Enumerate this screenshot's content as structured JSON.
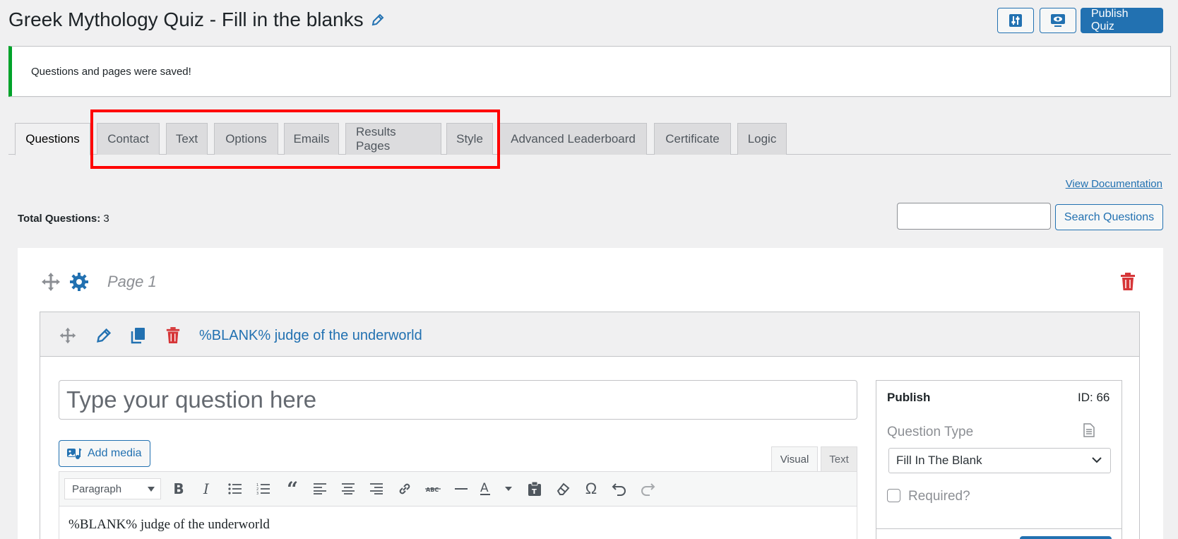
{
  "header": {
    "title": "Greek Mythology Quiz - Fill in the blanks",
    "publish_label": "Publish Quiz"
  },
  "notice": {
    "message": "Questions and pages were saved!"
  },
  "tabs": [
    {
      "label": "Questions"
    },
    {
      "label": "Contact"
    },
    {
      "label": "Text"
    },
    {
      "label": "Options"
    },
    {
      "label": "Emails"
    },
    {
      "label": "Results Pages"
    },
    {
      "label": "Style"
    },
    {
      "label": "Advanced Leaderboard"
    },
    {
      "label": "Certificate"
    },
    {
      "label": "Logic"
    }
  ],
  "links": {
    "view_documentation": "View Documentation"
  },
  "questions_summary": {
    "total_label": "Total Questions:",
    "total_value": "3",
    "search_button": "Search Questions",
    "search_value": ""
  },
  "page": {
    "label": "Page 1"
  },
  "question": {
    "title": "%BLANK% judge of the underworld",
    "placeholder": "Type your question here",
    "add_media_label": "Add media",
    "editor_tabs": {
      "visual": "Visual",
      "text": "Text"
    },
    "format_select": "Paragraph",
    "body_text": "%BLANK% judge of the underworld"
  },
  "publish_box": {
    "title": "Publish",
    "id_text": "ID: 66",
    "question_type_label": "Question Type",
    "question_type_value": "Fill In The Blank",
    "required_label": "Required?"
  },
  "colors": {
    "accent": "#2271b1",
    "danger": "#d63638",
    "success": "#00a32a",
    "highlight": "#ff0000"
  },
  "icons": [
    "pencil-icon",
    "sliders-icon",
    "preview-icon",
    "move-icon",
    "gear-icon",
    "trash-icon",
    "copy-icon",
    "add-media-icon",
    "document-icon",
    "chevron-down-icon"
  ]
}
